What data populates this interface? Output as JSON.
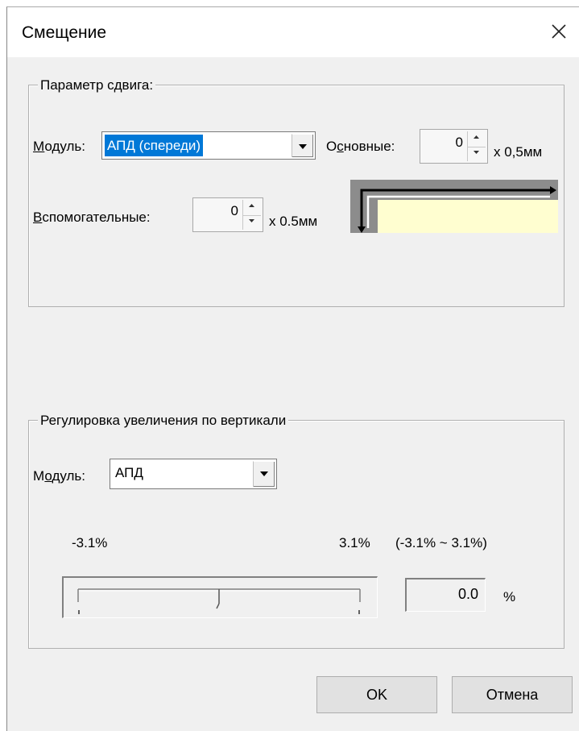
{
  "window": {
    "title": "Смещение"
  },
  "shift_group": {
    "label": "Параметр сдвига:",
    "module_label_prefix": "",
    "module_label_accel": "М",
    "module_label_rest": "одуль:",
    "module_value": "АПД (спереди)",
    "main_label_pre": "О",
    "main_label_accel": "с",
    "main_label_rest": "новные:",
    "main_value": "0",
    "main_unit": "x 0,5мм",
    "aux_label_accel": "В",
    "aux_label_rest": "спомогательные:",
    "aux_value": "0",
    "aux_unit": "x 0.5мм"
  },
  "zoom_group": {
    "label": "Регулировка увеличения по вертикали",
    "module_label_pre": "М",
    "module_label_accel": "о",
    "module_label_rest": "дуль:",
    "module_value": "АПД",
    "min_label": "-3.1%",
    "max_label": "3.1%",
    "range_label": "(-3.1% ~ 3.1%)",
    "slider": {
      "min": -3.1,
      "max": 3.1,
      "value": 0.0
    },
    "value": "0.0",
    "unit": "%"
  },
  "buttons": {
    "ok": "OK",
    "cancel": "Отмена"
  },
  "icons": {
    "close": "close-icon",
    "dropdown": "chevron-down-icon",
    "spin_up": "caret-up-icon",
    "spin_down": "caret-down-icon"
  }
}
